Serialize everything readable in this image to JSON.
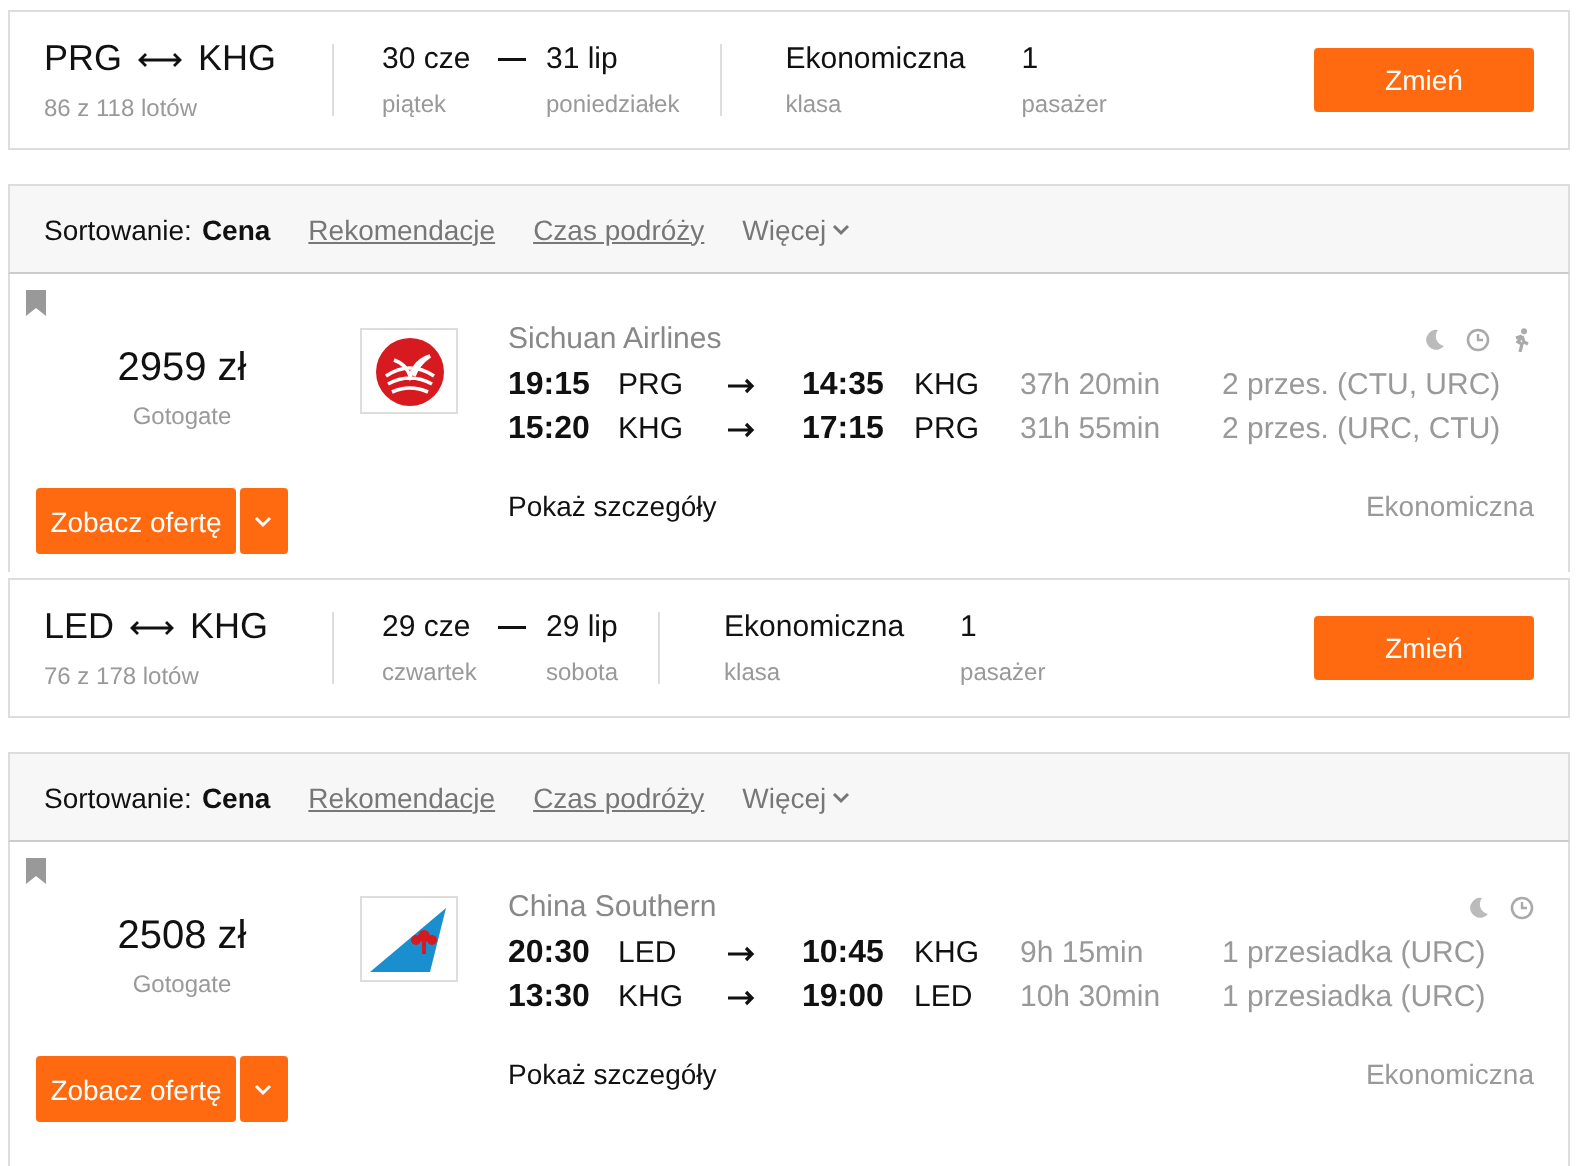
{
  "blocks": [
    {
      "search": {
        "from": "PRG",
        "to": "KHG",
        "count": "86 z 118 lotów",
        "depart": {
          "date": "30 cze",
          "day": "piątek"
        },
        "return": {
          "date": "31 lip",
          "day": "poniedziałek"
        },
        "cabin": {
          "value": "Ekonomiczna",
          "label": "klasa"
        },
        "passengers": {
          "value": "1",
          "label": "pasażer"
        },
        "button": "Zmień"
      },
      "sort": {
        "label": "Sortowanie:",
        "options": [
          {
            "label": "Cena",
            "selected": true
          },
          {
            "label": "Rekomendacje",
            "selected": false
          },
          {
            "label": "Czas podróży",
            "selected": false
          }
        ],
        "more": "Więcej"
      },
      "result": {
        "price": "2959 zł",
        "seller": "Gotogate",
        "airline": "Sichuan Airlines",
        "logo": {
          "kind": "bird"
        },
        "features": [
          {
            "kind": "night"
          },
          {
            "kind": "clock"
          },
          {
            "kind": "walk"
          }
        ],
        "legs": [
          {
            "dep_time": "19:15",
            "dep": "PRG",
            "arr_time": "14:35",
            "arr": "KHG",
            "duration": "37h 20min",
            "stops": "2 przes. (CTU, URC)"
          },
          {
            "dep_time": "15:20",
            "dep": "KHG",
            "arr_time": "17:15",
            "arr": "PRG",
            "duration": "31h 55min",
            "stops": "2 przes. (URC, CTU)"
          }
        ],
        "button": "Zobacz ofertę",
        "details": "Pokaż szczegóły",
        "cabin": "Ekonomiczna"
      }
    },
    {
      "search": {
        "from": "LED",
        "to": "KHG",
        "count": "76 z 178 lotów",
        "depart": {
          "date": "29 cze",
          "day": "czwartek"
        },
        "return": {
          "date": "29 lip",
          "day": "sobota"
        },
        "cabin": {
          "value": "Ekonomiczna",
          "label": "klasa"
        },
        "passengers": {
          "value": "1",
          "label": "pasażer"
        },
        "button": "Zmień"
      },
      "sort": {
        "label": "Sortowanie:",
        "options": [
          {
            "label": "Cena",
            "selected": true
          },
          {
            "label": "Rekomendacje",
            "selected": false
          },
          {
            "label": "Czas podróży",
            "selected": false
          }
        ],
        "more": "Więcej"
      },
      "result": {
        "price": "2508 zł",
        "seller": "Gotogate",
        "airline": "China Southern",
        "logo": {
          "kind": "tail"
        },
        "features": [
          {
            "kind": "night"
          },
          {
            "kind": "clock"
          }
        ],
        "legs": [
          {
            "dep_time": "20:30",
            "dep": "LED",
            "arr_time": "10:45",
            "arr": "KHG",
            "duration": "9h 15min",
            "stops": "1 przesiadka (URC)"
          },
          {
            "dep_time": "13:30",
            "dep": "KHG",
            "arr_time": "19:00",
            "arr": "LED",
            "duration": "10h 30min",
            "stops": "1 przesiadka (URC)"
          }
        ],
        "button": "Zobacz ofertę",
        "details": "Pokaż szczegóły",
        "cabin": "Ekonomiczna"
      }
    }
  ]
}
